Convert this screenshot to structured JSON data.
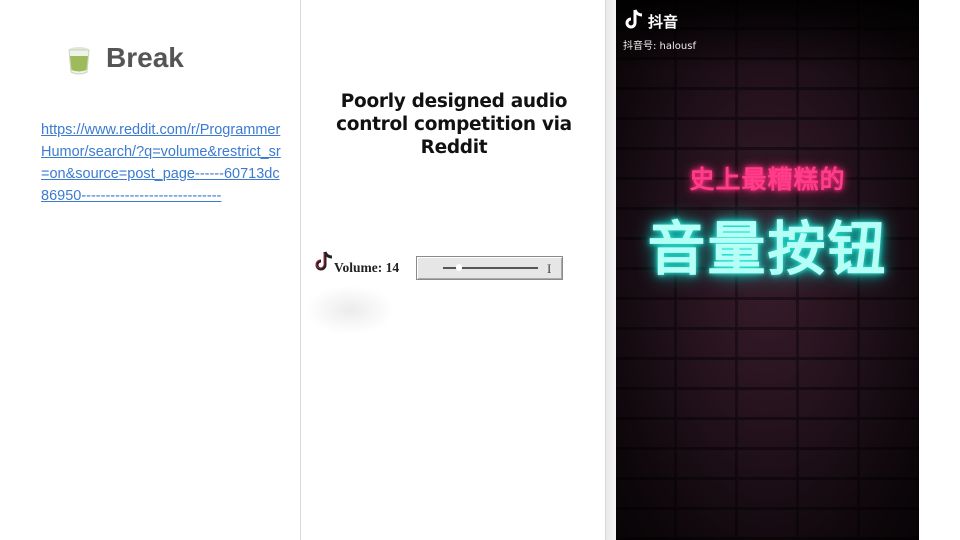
{
  "slide": {
    "title": "Break",
    "cup_icon": "green-tea-cup-icon",
    "link": "https://www.reddit.com/r/ProgrammerHumor/search/?q=volume&restrict_sr=on&source=post_page------60713dc86950-----------------------------"
  },
  "video_left": {
    "heading": "Poorly designed audio control competition via Reddit",
    "volume_label": "Volume: 14",
    "volume_value": 14,
    "slider_cursor": "I"
  },
  "video_right": {
    "app_name": "抖音",
    "account": "抖音号: halousf",
    "caption_top": "史上最糟糕的",
    "caption_big": "音量按钮",
    "colors": {
      "pink_neon": "#ff3d8a",
      "cyan_neon": "#2ee8d8"
    }
  }
}
